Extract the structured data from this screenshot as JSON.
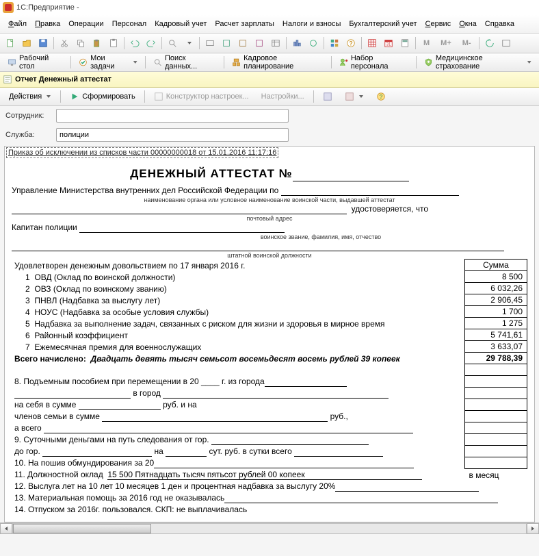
{
  "title": "1С:Предприятие - ",
  "menu": {
    "file": "Файл",
    "edit": "Правка",
    "ops": "Операции",
    "pers": "Персонал",
    "kadr": "Кадровый учет",
    "calc": "Расчет зарплаты",
    "tax": "Налоги и взносы",
    "buh": "Бухгалтерский учет",
    "srv": "Сервис",
    "win": "Окна",
    "help": "Справка"
  },
  "quickbar": {
    "desktop": "Рабочий стол",
    "tasks": "Мои задачи",
    "search": "Поиск данных...",
    "plan": "Кадровое планирование",
    "nabor": "Набор персонала",
    "med": "Медицинское страхование"
  },
  "doc_tab": {
    "title": "Отчет  Денежный аттестат"
  },
  "actions": {
    "act": "Действия",
    "form": "Сформировать",
    "constr": "Конструктор настроек...",
    "settings": "Настройки..."
  },
  "fields": {
    "employee_lbl": "Сотрудник:",
    "employee_val": "",
    "service_lbl": "Служба:",
    "service_val": "полиции"
  },
  "prikaz": "Приказ об исключении из списков части 00000000018 от 15.01.2016 11:17:16",
  "doc": {
    "heading": "ДЕНЕЖНЫЙ АТТЕСТАТ №",
    "org": "Управление Министерства внутренних дел Российской Федерации по",
    "org_caption": "наименование органа или условное наименование воинской части, выдавшей аттестат",
    "udost": "удостоверяется, что",
    "addr_caption": "почтовый адрес",
    "rank": "Капитан полиции",
    "rank_caption": "воинское звание, фамилия, имя, отчество",
    "post_caption": "штатной воинской должности",
    "satisfied": "Удовлетворен денежным довольствием по 17 января 2016 г.",
    "sum_header": "Сумма",
    "rows": [
      {
        "n": "1",
        "name": "ОВД (Оклад по воинской должности)",
        "sum": "8 500"
      },
      {
        "n": "2",
        "name": "ОВЗ (Оклад по воинскому званию)",
        "sum": "6 032,26"
      },
      {
        "n": "3",
        "name": "ПНВЛ (Надбавка за выслугу лет)",
        "sum": "2 906,45"
      },
      {
        "n": "4",
        "name": "НОУС (Надбавка за особые условия службы)",
        "sum": "1 700"
      },
      {
        "n": "5",
        "name": "Надбавка за выполнение задач, связанных с риском для жизни и здоровья в мирное время",
        "sum": "1 275"
      },
      {
        "n": "6",
        "name": "Районный коэффициент",
        "sum": "5 741,61"
      },
      {
        "n": "7",
        "name": "Ежемесячная премия для военнослужащих",
        "sum": "3 633,07"
      }
    ],
    "total_lbl": "Всего начислено:",
    "total_words": "Двадцать девять тысяч семьсот восемьдесят восемь рублей 39 копеек",
    "total_sum": "29 788,39",
    "l8": "8.    Подъемным пособием при перемещении   в  20 ____   г.  из города",
    "l8b": "в город",
    "l_self": "на себя в сумме",
    "rub_and": "руб.  и на",
    "l_family": "членов семьи в сумме",
    "rub_dot": "руб.,",
    "l_total": "а всего",
    "l9": "9.    Суточными деньгами на путь следования от гор.",
    "l9b": "до гор.",
    "l9c": "на",
    "l9d": "сут. руб. в сутки всего",
    "l10": "10.   На пошив обмундирования за 20",
    "l11": "11.   Должностной оклад",
    "l11v": "15 500 Пятнадцать тысяч пятьсот рублей 00 копеек",
    "l11m": "в месяц",
    "l12": "12.   Выслуга лет на   10 лет 10 месяцев 1 ден  и процентная надбавка за выслугу 20%",
    "l13": "13.   Материальная помощь за 2016 год не оказывалась",
    "l14": "14.   Отпуском за 2016г.               пользовался. СКП: не выплачивалась"
  }
}
